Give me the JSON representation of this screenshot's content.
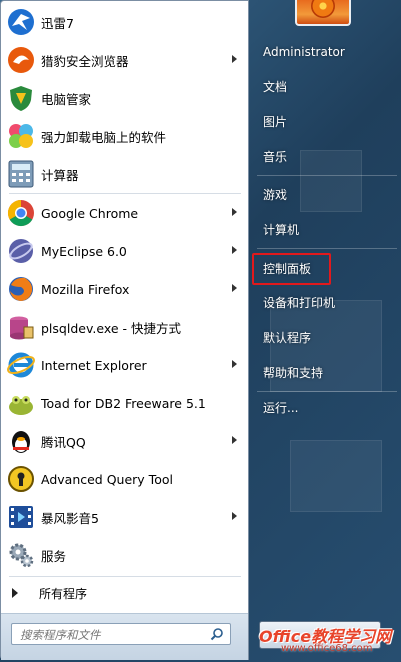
{
  "programs": [
    {
      "label": "迅雷7",
      "icon": "thunder-bird-icon",
      "submenu": false
    },
    {
      "label": "猎豹安全浏览器",
      "icon": "cheetah-browser-icon",
      "submenu": true
    },
    {
      "label": "电脑管家",
      "icon": "shield-v-icon",
      "submenu": false
    },
    {
      "label": "强力卸载电脑上的软件",
      "icon": "pinwheel-icon",
      "submenu": false
    },
    {
      "label": "计算器",
      "icon": "calculator-icon",
      "submenu": false
    },
    {
      "label": "Google Chrome",
      "icon": "chrome-icon",
      "submenu": true
    },
    {
      "label": "MyEclipse 6.0",
      "icon": "myeclipse-icon",
      "submenu": true
    },
    {
      "label": "Mozilla Firefox",
      "icon": "firefox-icon",
      "submenu": true
    },
    {
      "label": "plsqldev.exe - 快捷方式",
      "icon": "plsql-db-icon",
      "submenu": false
    },
    {
      "label": "Internet Explorer",
      "icon": "ie-icon",
      "submenu": true
    },
    {
      "label": "Toad for DB2 Freeware 5.1",
      "icon": "toad-icon",
      "submenu": false
    },
    {
      "label": "腾讯QQ",
      "icon": "qq-penguin-icon",
      "submenu": true
    },
    {
      "label": "Advanced Query Tool",
      "icon": "keyhole-icon",
      "submenu": false
    },
    {
      "label": "暴风影音5",
      "icon": "film-strip-icon",
      "submenu": true
    },
    {
      "label": "服务",
      "icon": "gears-icon",
      "submenu": false
    }
  ],
  "all_programs_label": "所有程序",
  "search": {
    "placeholder": "搜索程序和文件"
  },
  "right_items": [
    {
      "label": "Administrator"
    },
    {
      "label": "文档"
    },
    {
      "label": "图片"
    },
    {
      "label": "音乐"
    },
    {
      "label": "游戏"
    },
    {
      "label": "计算机"
    },
    {
      "label": "控制面板"
    },
    {
      "label": "设备和打印机"
    },
    {
      "label": "默认程序"
    },
    {
      "label": "帮助和支持"
    },
    {
      "label": "运行..."
    }
  ],
  "highlighted_item": "控制面板",
  "highlight_color": "#e2191c",
  "watermark": {
    "main": "Office教程学习网",
    "url": "www.office68.com"
  }
}
